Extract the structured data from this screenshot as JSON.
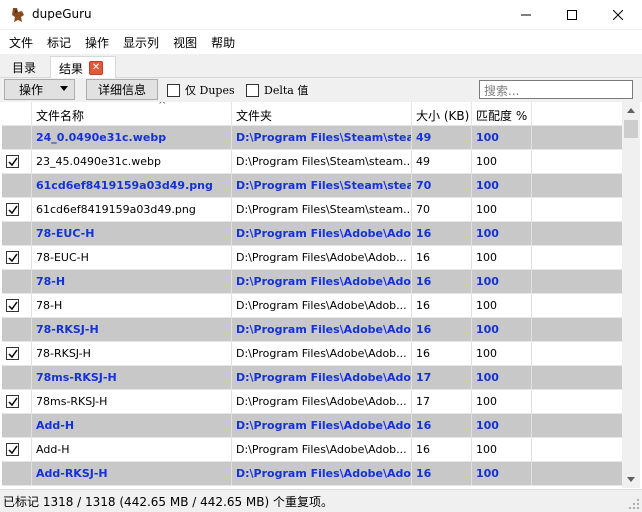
{
  "window": {
    "title": "dupeGuru"
  },
  "menu": {
    "items": [
      "文件",
      "标记",
      "操作",
      "显示列",
      "视图",
      "帮助"
    ]
  },
  "tabs": {
    "catalog": "目录",
    "results": "结果",
    "close_glyph": "✕"
  },
  "toolbar": {
    "actions_label": "操作",
    "details_label": "详细信息",
    "only_dupes_label": "仅 Dupes",
    "delta_label": "Delta 值",
    "search_placeholder": "搜索..."
  },
  "columns": [
    "文件名称",
    "文件夹",
    "大小 (KB)",
    "匹配度 %"
  ],
  "rows": [
    {
      "type": "ref",
      "checked": false,
      "name": "24_0.0490e31c.webp",
      "folder": "D:\\Program Files\\Steam\\stea...",
      "size": "49",
      "match": "100"
    },
    {
      "type": "dup",
      "checked": true,
      "name": "23_45.0490e31c.webp",
      "folder": "D:\\Program Files\\Steam\\steam...",
      "size": "49",
      "match": "100"
    },
    {
      "type": "ref",
      "checked": false,
      "name": "61cd6ef8419159a03d49.png",
      "folder": "D:\\Program Files\\Steam\\stea...",
      "size": "70",
      "match": "100"
    },
    {
      "type": "dup",
      "checked": true,
      "name": "61cd6ef8419159a03d49.png",
      "folder": "D:\\Program Files\\Steam\\steam...",
      "size": "70",
      "match": "100"
    },
    {
      "type": "ref",
      "checked": false,
      "name": "78-EUC-H",
      "folder": "D:\\Program Files\\Adobe\\Ado...",
      "size": "16",
      "match": "100"
    },
    {
      "type": "dup",
      "checked": true,
      "name": "78-EUC-H",
      "folder": "D:\\Program Files\\Adobe\\Adob...",
      "size": "16",
      "match": "100"
    },
    {
      "type": "ref",
      "checked": false,
      "name": "78-H",
      "folder": "D:\\Program Files\\Adobe\\Ado...",
      "size": "16",
      "match": "100"
    },
    {
      "type": "dup",
      "checked": true,
      "name": "78-H",
      "folder": "D:\\Program Files\\Adobe\\Adob...",
      "size": "16",
      "match": "100"
    },
    {
      "type": "ref",
      "checked": false,
      "name": "78-RKSJ-H",
      "folder": "D:\\Program Files\\Adobe\\Ado...",
      "size": "16",
      "match": "100"
    },
    {
      "type": "dup",
      "checked": true,
      "name": "78-RKSJ-H",
      "folder": "D:\\Program Files\\Adobe\\Adob...",
      "size": "16",
      "match": "100"
    },
    {
      "type": "ref",
      "checked": false,
      "name": "78ms-RKSJ-H",
      "folder": "D:\\Program Files\\Adobe\\Ado...",
      "size": "17",
      "match": "100"
    },
    {
      "type": "dup",
      "checked": true,
      "name": "78ms-RKSJ-H",
      "folder": "D:\\Program Files\\Adobe\\Adob...",
      "size": "17",
      "match": "100"
    },
    {
      "type": "ref",
      "checked": false,
      "name": "Add-H",
      "folder": "D:\\Program Files\\Adobe\\Ado...",
      "size": "16",
      "match": "100"
    },
    {
      "type": "dup",
      "checked": true,
      "name": "Add-H",
      "folder": "D:\\Program Files\\Adobe\\Adob...",
      "size": "16",
      "match": "100"
    },
    {
      "type": "ref",
      "checked": false,
      "name": "Add-RKSJ-H",
      "folder": "D:\\Program Files\\Adobe\\Ado...",
      "size": "16",
      "match": "100"
    }
  ],
  "status": {
    "text": "已标记 1318 / 1318 (442.65 MB / 442.65 MB) 个重复项。"
  },
  "colors": {
    "ref_text": "#1432d6",
    "ref_bg": "#c8c8c8",
    "tab_close": "#e05a3a"
  }
}
